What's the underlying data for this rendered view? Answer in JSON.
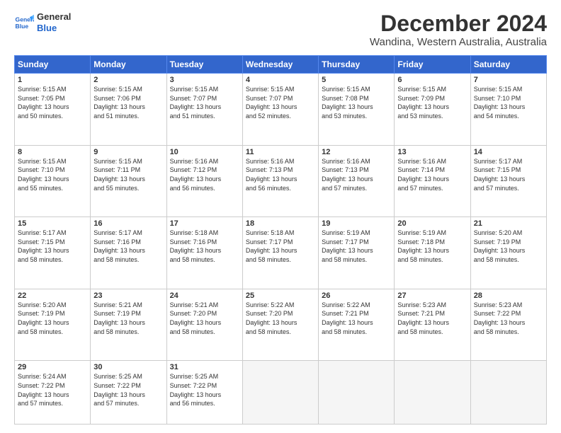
{
  "logo": {
    "line1": "General",
    "line2": "Blue"
  },
  "title": "December 2024",
  "subtitle": "Wandina, Western Australia, Australia",
  "header_days": [
    "Sunday",
    "Monday",
    "Tuesday",
    "Wednesday",
    "Thursday",
    "Friday",
    "Saturday"
  ],
  "weeks": [
    [
      {
        "day": "1",
        "info": "Sunrise: 5:15 AM\nSunset: 7:05 PM\nDaylight: 13 hours\nand 50 minutes."
      },
      {
        "day": "2",
        "info": "Sunrise: 5:15 AM\nSunset: 7:06 PM\nDaylight: 13 hours\nand 51 minutes."
      },
      {
        "day": "3",
        "info": "Sunrise: 5:15 AM\nSunset: 7:07 PM\nDaylight: 13 hours\nand 51 minutes."
      },
      {
        "day": "4",
        "info": "Sunrise: 5:15 AM\nSunset: 7:07 PM\nDaylight: 13 hours\nand 52 minutes."
      },
      {
        "day": "5",
        "info": "Sunrise: 5:15 AM\nSunset: 7:08 PM\nDaylight: 13 hours\nand 53 minutes."
      },
      {
        "day": "6",
        "info": "Sunrise: 5:15 AM\nSunset: 7:09 PM\nDaylight: 13 hours\nand 53 minutes."
      },
      {
        "day": "7",
        "info": "Sunrise: 5:15 AM\nSunset: 7:10 PM\nDaylight: 13 hours\nand 54 minutes."
      }
    ],
    [
      {
        "day": "8",
        "info": "Sunrise: 5:15 AM\nSunset: 7:10 PM\nDaylight: 13 hours\nand 55 minutes."
      },
      {
        "day": "9",
        "info": "Sunrise: 5:15 AM\nSunset: 7:11 PM\nDaylight: 13 hours\nand 55 minutes."
      },
      {
        "day": "10",
        "info": "Sunrise: 5:16 AM\nSunset: 7:12 PM\nDaylight: 13 hours\nand 56 minutes."
      },
      {
        "day": "11",
        "info": "Sunrise: 5:16 AM\nSunset: 7:13 PM\nDaylight: 13 hours\nand 56 minutes."
      },
      {
        "day": "12",
        "info": "Sunrise: 5:16 AM\nSunset: 7:13 PM\nDaylight: 13 hours\nand 57 minutes."
      },
      {
        "day": "13",
        "info": "Sunrise: 5:16 AM\nSunset: 7:14 PM\nDaylight: 13 hours\nand 57 minutes."
      },
      {
        "day": "14",
        "info": "Sunrise: 5:17 AM\nSunset: 7:15 PM\nDaylight: 13 hours\nand 57 minutes."
      }
    ],
    [
      {
        "day": "15",
        "info": "Sunrise: 5:17 AM\nSunset: 7:15 PM\nDaylight: 13 hours\nand 58 minutes."
      },
      {
        "day": "16",
        "info": "Sunrise: 5:17 AM\nSunset: 7:16 PM\nDaylight: 13 hours\nand 58 minutes."
      },
      {
        "day": "17",
        "info": "Sunrise: 5:18 AM\nSunset: 7:16 PM\nDaylight: 13 hours\nand 58 minutes."
      },
      {
        "day": "18",
        "info": "Sunrise: 5:18 AM\nSunset: 7:17 PM\nDaylight: 13 hours\nand 58 minutes."
      },
      {
        "day": "19",
        "info": "Sunrise: 5:19 AM\nSunset: 7:17 PM\nDaylight: 13 hours\nand 58 minutes."
      },
      {
        "day": "20",
        "info": "Sunrise: 5:19 AM\nSunset: 7:18 PM\nDaylight: 13 hours\nand 58 minutes."
      },
      {
        "day": "21",
        "info": "Sunrise: 5:20 AM\nSunset: 7:19 PM\nDaylight: 13 hours\nand 58 minutes."
      }
    ],
    [
      {
        "day": "22",
        "info": "Sunrise: 5:20 AM\nSunset: 7:19 PM\nDaylight: 13 hours\nand 58 minutes."
      },
      {
        "day": "23",
        "info": "Sunrise: 5:21 AM\nSunset: 7:19 PM\nDaylight: 13 hours\nand 58 minutes."
      },
      {
        "day": "24",
        "info": "Sunrise: 5:21 AM\nSunset: 7:20 PM\nDaylight: 13 hours\nand 58 minutes."
      },
      {
        "day": "25",
        "info": "Sunrise: 5:22 AM\nSunset: 7:20 PM\nDaylight: 13 hours\nand 58 minutes."
      },
      {
        "day": "26",
        "info": "Sunrise: 5:22 AM\nSunset: 7:21 PM\nDaylight: 13 hours\nand 58 minutes."
      },
      {
        "day": "27",
        "info": "Sunrise: 5:23 AM\nSunset: 7:21 PM\nDaylight: 13 hours\nand 58 minutes."
      },
      {
        "day": "28",
        "info": "Sunrise: 5:23 AM\nSunset: 7:22 PM\nDaylight: 13 hours\nand 58 minutes."
      }
    ],
    [
      {
        "day": "29",
        "info": "Sunrise: 5:24 AM\nSunset: 7:22 PM\nDaylight: 13 hours\nand 57 minutes."
      },
      {
        "day": "30",
        "info": "Sunrise: 5:25 AM\nSunset: 7:22 PM\nDaylight: 13 hours\nand 57 minutes."
      },
      {
        "day": "31",
        "info": "Sunrise: 5:25 AM\nSunset: 7:22 PM\nDaylight: 13 hours\nand 56 minutes."
      },
      {
        "day": "",
        "info": ""
      },
      {
        "day": "",
        "info": ""
      },
      {
        "day": "",
        "info": ""
      },
      {
        "day": "",
        "info": ""
      }
    ]
  ]
}
